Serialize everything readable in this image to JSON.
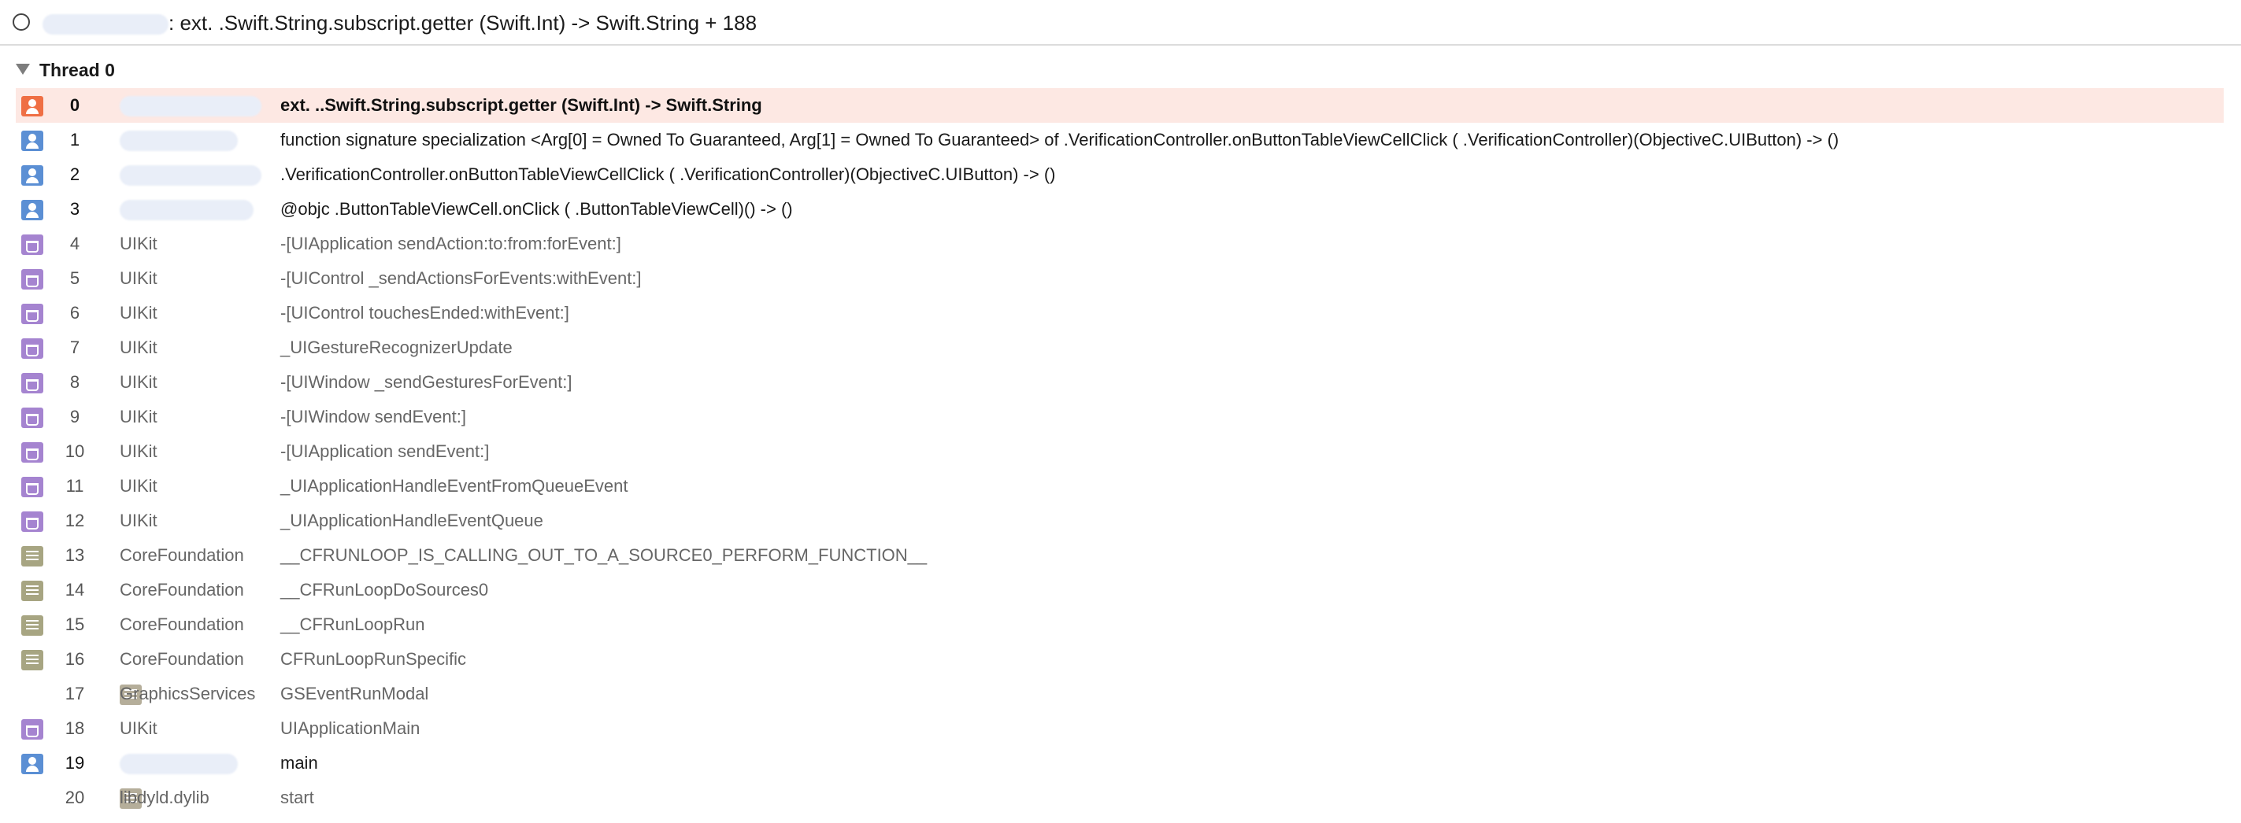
{
  "header": {
    "title": ": ext.                 .Swift.String.subscript.getter (Swift.Int) -> Swift.String + 188"
  },
  "thread": {
    "label": "Thread 0"
  },
  "frames": [
    {
      "num": "0",
      "library": "",
      "function": "ext.                  ..Swift.String.subscript.getter (Swift.Int) -> Swift.String",
      "icon": "user-sel"
    },
    {
      "num": "1",
      "library": "",
      "function": "function signature specialization <Arg[0] = Owned To Guaranteed, Arg[1] = Owned To Guaranteed> of                  .VerificationController.onButtonTableViewCellClick (                   .VerificationController)(ObjectiveC.UIButton) -> ()",
      "icon": "user"
    },
    {
      "num": "2",
      "library": "",
      "function": "                  .VerificationController.onButtonTableViewCellClick (                  .VerificationController)(ObjectiveC.UIButton) -> ()",
      "icon": "user"
    },
    {
      "num": "3",
      "library": "",
      "function": "@objc                   .ButtonTableViewCell.onClick (                  .ButtonTableViewCell)() -> ()",
      "icon": "user"
    },
    {
      "num": "4",
      "library": "UIKit",
      "function": "-[UIApplication sendAction:to:from:forEvent:]",
      "icon": "sys"
    },
    {
      "num": "5",
      "library": "UIKit",
      "function": "-[UIControl _sendActionsForEvents:withEvent:]",
      "icon": "sys"
    },
    {
      "num": "6",
      "library": "UIKit",
      "function": "-[UIControl touchesEnded:withEvent:]",
      "icon": "sys"
    },
    {
      "num": "7",
      "library": "UIKit",
      "function": "_UIGestureRecognizerUpdate",
      "icon": "sys"
    },
    {
      "num": "8",
      "library": "UIKit",
      "function": "-[UIWindow _sendGesturesForEvent:]",
      "icon": "sys"
    },
    {
      "num": "9",
      "library": "UIKit",
      "function": "-[UIWindow sendEvent:]",
      "icon": "sys"
    },
    {
      "num": "10",
      "library": "UIKit",
      "function": "-[UIApplication sendEvent:]",
      "icon": "sys"
    },
    {
      "num": "11",
      "library": "UIKit",
      "function": "_UIApplicationHandleEventFromQueueEvent",
      "icon": "sys"
    },
    {
      "num": "12",
      "library": "UIKit",
      "function": "_UIApplicationHandleEventQueue",
      "icon": "sys"
    },
    {
      "num": "13",
      "library": "CoreFoundation",
      "function": "__CFRUNLOOP_IS_CALLING_OUT_TO_A_SOURCE0_PERFORM_FUNCTION__",
      "icon": "cf"
    },
    {
      "num": "14",
      "library": "CoreFoundation",
      "function": "__CFRunLoopDoSources0",
      "icon": "cf"
    },
    {
      "num": "15",
      "library": "CoreFoundation",
      "function": "__CFRunLoopRun",
      "icon": "cf"
    },
    {
      "num": "16",
      "library": "CoreFoundation",
      "function": "CFRunLoopRunSpecific",
      "icon": "cf"
    },
    {
      "num": "17",
      "library": "GraphicsServices",
      "function": "GSEventRunModal",
      "icon": "lib"
    },
    {
      "num": "18",
      "library": "UIKit",
      "function": "UIApplicationMain",
      "icon": "sys"
    },
    {
      "num": "19",
      "library": "",
      "function": "main",
      "icon": "user"
    },
    {
      "num": "20",
      "library": "libdyld.dylib",
      "function": "start",
      "icon": "lib"
    }
  ]
}
